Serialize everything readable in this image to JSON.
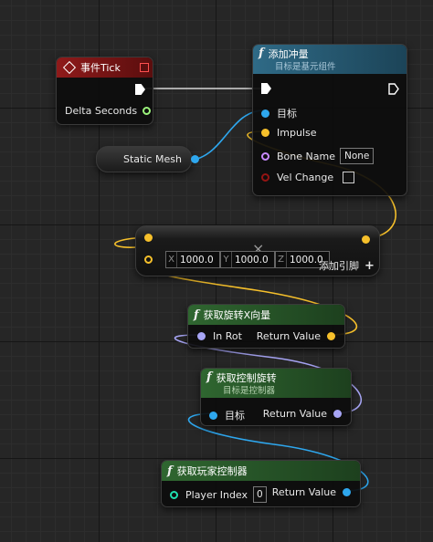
{
  "event_tick": {
    "title": "事件Tick",
    "output_label": "Delta Seconds"
  },
  "add_impulse": {
    "title": "添加冲量",
    "subtitle": "目标是基元组件",
    "pins": {
      "target": "目标",
      "impulse": "Impulse",
      "bone_name": "Bone Name",
      "bone_name_value": "None",
      "vel_change": "Vel Change"
    }
  },
  "static_mesh": {
    "label": "Static Mesh"
  },
  "multiply": {
    "x_axis": "X",
    "x_value": "1000.0",
    "y_axis": "Y",
    "y_value": "1000.0",
    "z_axis": "Z",
    "z_value": "1000.0",
    "add_pin_label": "添加引脚",
    "add_pin_icon": "+",
    "op_symbol": "×"
  },
  "get_rotation_x": {
    "title": "获取旋转X向量",
    "input_label": "In Rot",
    "output_label": "Return Value"
  },
  "get_control_rotation": {
    "title": "获取控制旋转",
    "subtitle": "目标是控制器",
    "input_label": "目标",
    "output_label": "Return Value"
  },
  "get_player_controller": {
    "title": "获取玩家控制器",
    "input_label": "Player Index",
    "input_value": "0",
    "output_label": "Return Value"
  },
  "icons": {
    "function": "f",
    "event": "event-diamond-icon"
  },
  "colors": {
    "exec": "#ffffff",
    "float": "#9cf47c",
    "vector": "#f6c02b",
    "object": "#2ea7ee",
    "rotator": "#a7a5f5",
    "name": "#c98aff",
    "bool": "#941413",
    "int": "#1fe0b0"
  }
}
